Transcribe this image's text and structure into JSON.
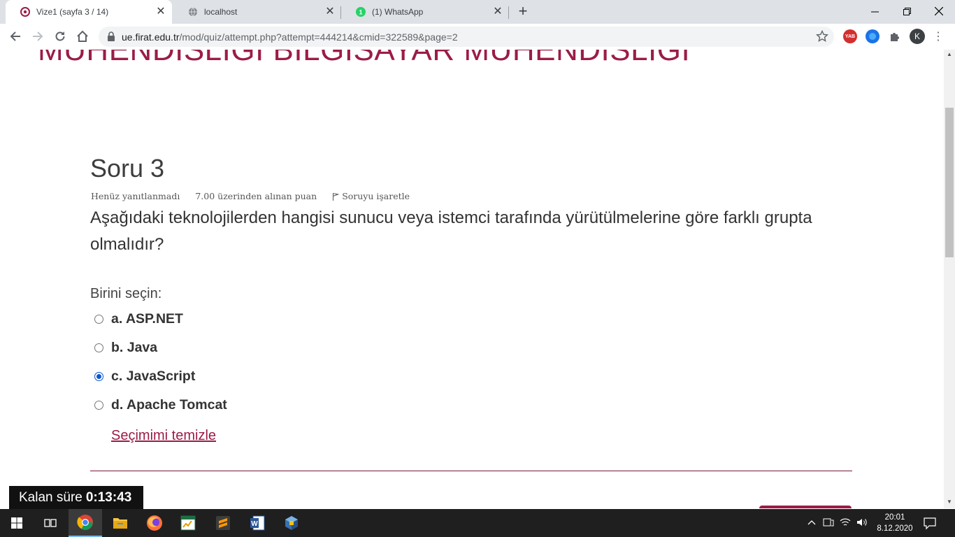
{
  "browser": {
    "tabs": [
      {
        "title": "Vize1 (sayfa 3 / 14)",
        "active": true,
        "icon": "moodle-icon"
      },
      {
        "title": "localhost",
        "active": false,
        "icon": "globe-icon"
      },
      {
        "title": "(1) WhatsApp",
        "active": false,
        "icon": "whatsapp-icon",
        "badge": "1"
      }
    ],
    "url_host": "ue.firat.edu.tr",
    "url_path": "/mod/quiz/attempt.php?attempt=444214&cmid=322589&page=2",
    "extensions": [
      {
        "label": "YAB",
        "color": "#d32f2f"
      },
      {
        "label": "",
        "color": "#1a73e8"
      }
    ],
    "profile_initial": "K"
  },
  "page": {
    "course_title": "MÜHENDİSLİĞİ BİLGİSAYAR MÜHENDİSLİĞİ",
    "question_heading": "Soru 3",
    "meta": {
      "status": "Henüz yanıtlanmadı",
      "points": "7.00 üzerinden alınan puan",
      "flag": "Soruyu işaretle"
    },
    "question_text": "Aşağıdaki teknolojilerden hangisi sunucu veya istemci tarafında yürütülmelerine göre farklı grupta olmalıdır?",
    "prompt": "Birini seçin:",
    "options": [
      {
        "label": "a. ASP.NET",
        "selected": false
      },
      {
        "label": "b. Java",
        "selected": false
      },
      {
        "label": "c. JavaScript",
        "selected": true
      },
      {
        "label": "d. Apache Tomcat",
        "selected": false
      }
    ],
    "clear_choice": "Seçimimi temizle",
    "timer_label": "Kalan süre",
    "timer_value": "0:13:43",
    "accent_color": "#9b1c47"
  },
  "taskbar": {
    "clock_time": "20:01",
    "clock_date": "8.12.2020",
    "apps": [
      "start-icon",
      "task-view-icon",
      "chrome-icon",
      "file-explorer-icon",
      "firefox-icon",
      "spreadsheet-icon",
      "sublime-text-icon",
      "word-icon",
      "virtualbox-icon"
    ]
  }
}
